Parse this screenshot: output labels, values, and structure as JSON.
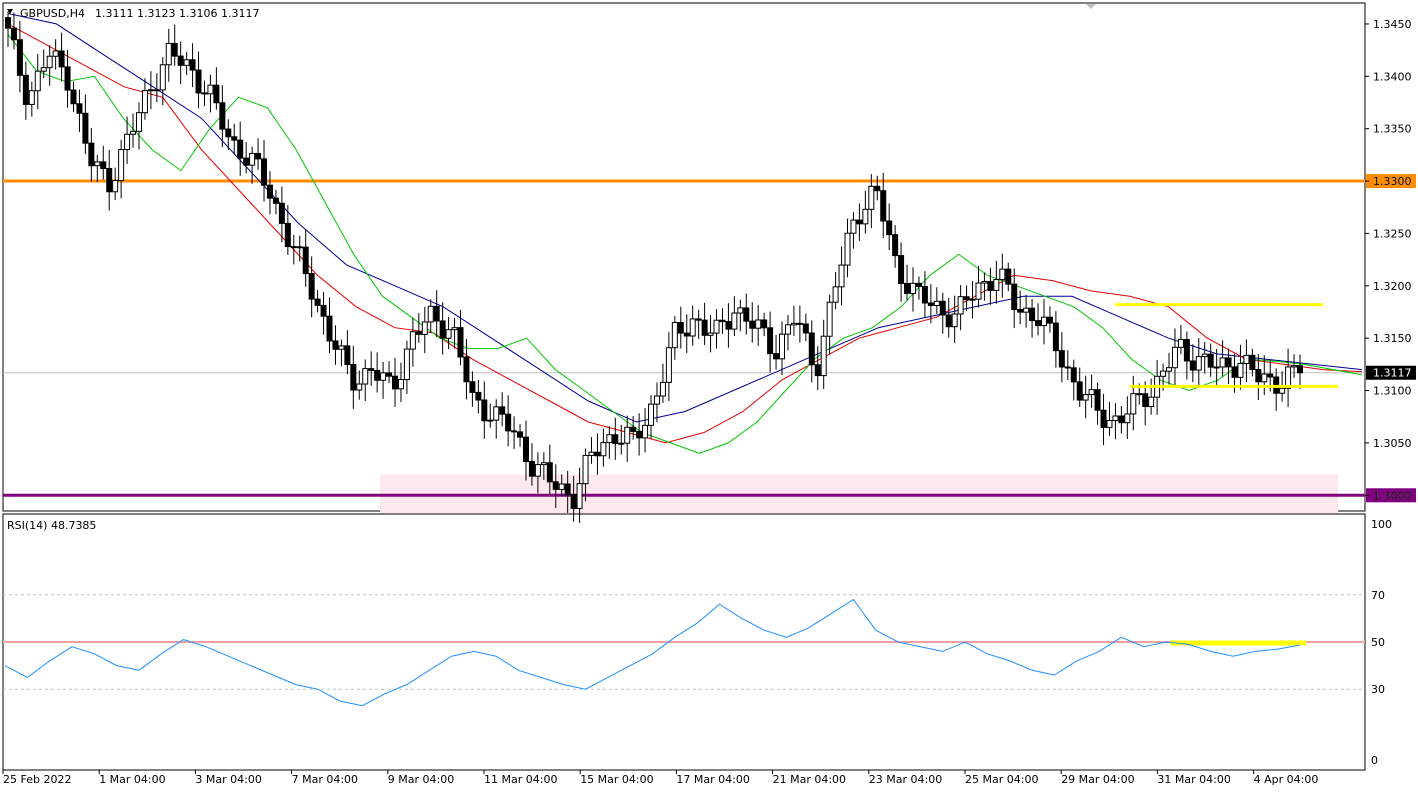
{
  "header": {
    "symbol_tf": "GBPUSD,H4",
    "ohlc": "1.3111 1.3123 1.3106 1.3117"
  },
  "rsi": {
    "label": "RSI(14) 48.7385"
  },
  "colors": {
    "up_candle": "#ffffff",
    "down_candle": "#000000",
    "ma_fast": "#00c800",
    "ma_mid": "#e60000",
    "ma_slow": "#000096",
    "rsi_line": "#1e90ff",
    "level_1_3300": "#ff8c00",
    "level_1_3000": "#800080",
    "zone": "#fde8f0",
    "range_lines": "#ffff00"
  },
  "chart_data": [
    {
      "type": "candlestick",
      "title": "GBPUSD,H4",
      "ylim": [
        1.2985,
        1.347
      ],
      "y_ticks": [
        1.345,
        1.34,
        1.335,
        1.33,
        1.325,
        1.32,
        1.315,
        1.31,
        1.305,
        1.3
      ],
      "current_price": 1.3117,
      "x_labels": [
        "25 Feb 2022",
        "1 Mar 04:00",
        "3 Mar 04:00",
        "7 Mar 04:00",
        "9 Mar 04:00",
        "11 Mar 04:00",
        "15 Mar 04:00",
        "17 Mar 04:00",
        "21 Mar 04:00",
        "23 Mar 04:00",
        "25 Mar 04:00",
        "29 Mar 04:00",
        "31 Mar 04:00",
        "4 Apr 04:00"
      ],
      "horizontal_levels": [
        {
          "price": 1.33,
          "label": "1.3300",
          "color": "#ff8c00"
        },
        {
          "price": 1.3,
          "label": "1.3000",
          "color": "#800080"
        }
      ],
      "support_zone": [
        1.2983,
        1.302
      ],
      "range_lines": [
        1.3182,
        1.3104
      ],
      "close_path": [
        1.344,
        1.338,
        1.342,
        1.34,
        1.332,
        1.33,
        1.334,
        1.339,
        1.342,
        1.341,
        1.338,
        1.334,
        1.332,
        1.329,
        1.324,
        1.32,
        1.315,
        1.311,
        1.312,
        1.31,
        1.315,
        1.317,
        1.316,
        1.309,
        1.308,
        1.306,
        1.303,
        1.301,
        1.3,
        1.304,
        1.306,
        1.305,
        1.309,
        1.315,
        1.317,
        1.315,
        1.318,
        1.316,
        1.314,
        1.317,
        1.312,
        1.32,
        1.327,
        1.329,
        1.322,
        1.319,
        1.318,
        1.317,
        1.32,
        1.321,
        1.318,
        1.317,
        1.314,
        1.31,
        1.308,
        1.307,
        1.309,
        1.311,
        1.314,
        1.313,
        1.312,
        1.313,
        1.311,
        1.311,
        1.3117
      ],
      "ma_fast": [
        1.344,
        1.3405,
        1.3395,
        1.34,
        1.336,
        1.333,
        1.331,
        1.335,
        1.338,
        1.337,
        1.333,
        1.328,
        1.323,
        1.319,
        1.317,
        1.315,
        1.314,
        1.314,
        1.315,
        1.312,
        1.31,
        1.308,
        1.306,
        1.305,
        1.304,
        1.305,
        1.307,
        1.31,
        1.313,
        1.315,
        1.316,
        1.318,
        1.321,
        1.323,
        1.321,
        1.32,
        1.319,
        1.318,
        1.316,
        1.313,
        1.311,
        1.31,
        1.311,
        1.313,
        1.3128,
        1.3125,
        1.312,
        1.3115
      ],
      "ma_mid": [
        1.345,
        1.343,
        1.341,
        1.339,
        1.338,
        1.333,
        1.329,
        1.325,
        1.321,
        1.318,
        1.316,
        1.3155,
        1.313,
        1.311,
        1.309,
        1.307,
        1.306,
        1.305,
        1.306,
        1.308,
        1.311,
        1.313,
        1.315,
        1.316,
        1.317,
        1.319,
        1.321,
        1.3205,
        1.3195,
        1.319,
        1.318,
        1.315,
        1.313,
        1.3125,
        1.312,
        1.3118
      ],
      "ma_slow": [
        1.346,
        1.345,
        1.342,
        1.339,
        1.336,
        1.331,
        1.326,
        1.322,
        1.32,
        1.318,
        1.315,
        1.312,
        1.309,
        1.307,
        1.308,
        1.31,
        1.312,
        1.314,
        1.316,
        1.317,
        1.318,
        1.319,
        1.319,
        1.317,
        1.315,
        1.3135,
        1.313,
        1.3125,
        1.312
      ]
    },
    {
      "type": "line",
      "title": "RSI(14) 48.7385",
      "ylim": [
        0,
        100
      ],
      "y_ticks": [
        100,
        70,
        50,
        30,
        0
      ],
      "levels": [
        70,
        50,
        30
      ],
      "values": [
        40,
        35,
        42,
        48,
        45,
        40,
        38,
        45,
        51,
        48,
        44,
        40,
        36,
        32,
        30,
        25,
        23,
        28,
        32,
        38,
        44,
        46,
        44,
        38,
        35,
        32,
        30,
        35,
        40,
        45,
        52,
        58,
        66,
        60,
        55,
        52,
        56,
        62,
        68,
        55,
        50,
        48,
        46,
        50,
        45,
        42,
        38,
        36,
        42,
        46,
        52,
        48,
        50,
        49,
        46,
        44,
        46,
        47,
        48.7385
      ]
    }
  ]
}
